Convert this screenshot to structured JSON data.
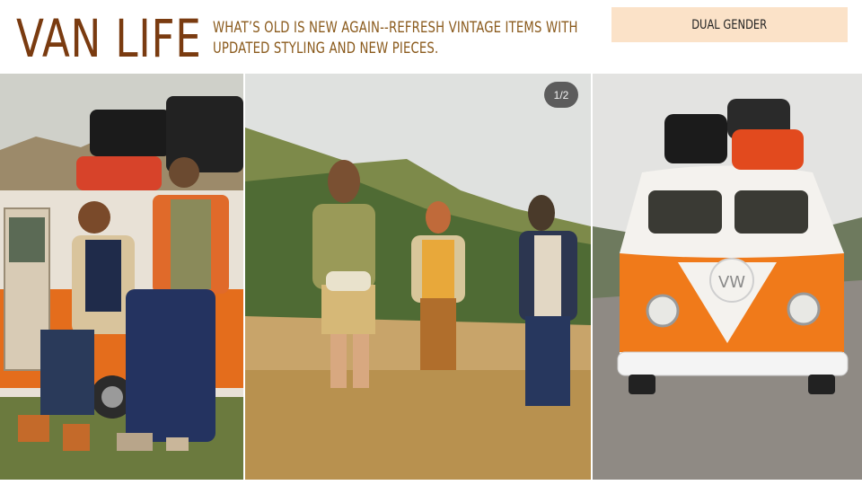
{
  "slide": {
    "title": "VAN LIFE",
    "subtitle": "What’s old is new again--refresh vintage items with updated styling and new pieces.",
    "badge": "DUAL GENDER",
    "pager": "1/2"
  },
  "colors": {
    "title": "#7a3b10",
    "subtitle": "#8a5a1c",
    "badge_bg": "#fbe2c8",
    "van_orange": "#f07a1a"
  },
  "photos": [
    {
      "id": "couple-by-van"
    },
    {
      "id": "three-walking-in-grass"
    },
    {
      "id": "vw-bus-front"
    }
  ]
}
